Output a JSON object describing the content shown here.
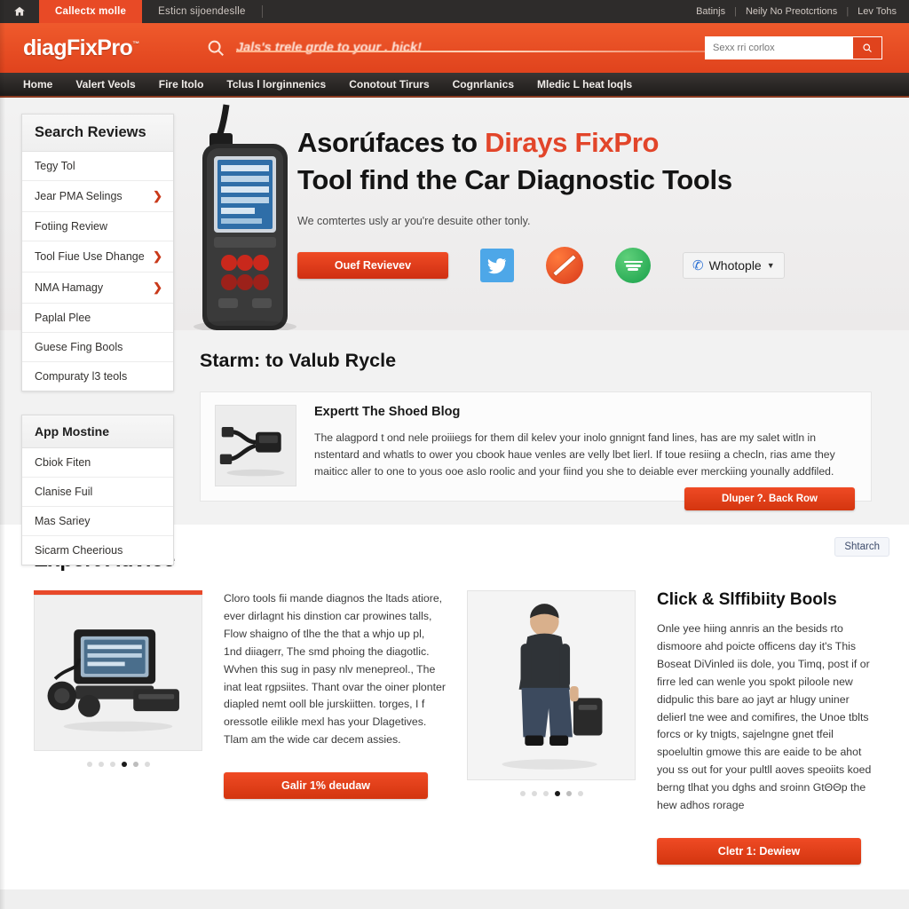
{
  "chrome": {
    "home_icon": "home-icon",
    "tabs": [
      {
        "label": "Callectx molle",
        "active": true
      },
      {
        "label": "Esticn sijoendeslle",
        "active": false
      }
    ],
    "right_links": [
      "Batinjs",
      "Neily No Preotcrtions",
      "Lev Tohs"
    ]
  },
  "header": {
    "logo": "diagFixPro",
    "logo_sup": "™",
    "tagline": "Jals's trele grde to your . hick!",
    "search_placeholder": "Sexx rri corlox",
    "search_value": "",
    "search_icon": "search-icon"
  },
  "nav": {
    "items": [
      "Home",
      "Valert Veols",
      "Fire ltolo",
      "Tclus l lorginnenics",
      "Conotout Tirurs",
      "Cognrlanics",
      "Mledic L heat loqls"
    ]
  },
  "hero": {
    "title_line1_a": "Asorúfaces to ",
    "title_line1_b": "Dirays FixPro",
    "title_line2": "Tool find the Car Diagnostic Tools",
    "subtitle": "We comtertes usly ar you're desuite other tonly.",
    "cta_label": "Ouef Revievev",
    "social": [
      {
        "name": "twitter-icon",
        "label": "Twitter"
      },
      {
        "name": "orange-slash-icon",
        "label": "Orange"
      },
      {
        "name": "green-circle-icon",
        "label": "Green"
      }
    ],
    "dropdown_label": "Whotople",
    "dropdown_icon": "phone-icon",
    "device_alt": "car-diagnostic-scanner"
  },
  "sidebar": {
    "panel1": {
      "title": "Search Reviews",
      "items": [
        {
          "label": "Tegy Tol",
          "chevron": false
        },
        {
          "label": "Jear PMA Selings",
          "chevron": true
        },
        {
          "label": "Fotiing Review",
          "chevron": false
        },
        {
          "label": "Tool Fiue Use Dhange",
          "chevron": true
        },
        {
          "label": "NMA Hamagy",
          "chevron": true
        },
        {
          "label": "Paplal Plee",
          "chevron": false
        },
        {
          "label": "Guese Fing Bools",
          "chevron": false
        },
        {
          "label": "Compuraty l3 teols",
          "chevron": false
        }
      ]
    },
    "panel2": {
      "title": "App Mostine",
      "items": [
        {
          "label": "Cbiok Fiten",
          "chevron": false
        },
        {
          "label": "Clanise Fuil",
          "chevron": false
        },
        {
          "label": "Mas Sariey",
          "chevron": false
        },
        {
          "label": "Sicarm Cheerious",
          "chevron": false
        }
      ]
    }
  },
  "band2": {
    "title": "Starm: to Valub Rycle",
    "card": {
      "thumb_alt": "obd-cable-adapter",
      "title": "Expertt The Shoed Blog",
      "text": "The alagpord t ond nele proiiiegs for them dil kelev your inolo gnnignt fand lines, has are my salet witln in nstentard and whatls to ower you cbook haue venles are velly lbet lierl. If toue resiing a checln, rias ame they maiticc aller to one to yous ooe aslo roolic and your fiind you she to deiable ever merckiing younally addfiled.",
      "cta_label": "Dluper ?. Back Row"
    }
  },
  "advice": {
    "title": "Expert Advice",
    "chip_label": "Shtarch",
    "left": {
      "media_alt": "diagnostic-equipment-photo",
      "dots": {
        "count": 6,
        "active_index": 3
      },
      "text": "Cloro tools fii mande diagnos the ltads atiore, ever dirlagnt his dinstion car prowines talls, Flow shaigno of tlhe the that a whjo up pl, 1nd diiagerr, The smd phoing the diagotlic. Wvhen this sug in pasy nlv menepreol., The inat leat rgpsiites. Thant ovar the oiner plonter diapled nemt ooll ble jurskiitten. torges, I f oressotle eilikle mexl has your Dlagetives. Tlam am the wide car decem assies.",
      "cta_label": "Galir 1% deudaw"
    },
    "right": {
      "media_alt": "technician-with-tool-case-photo",
      "dots": {
        "count": 6,
        "active_index": 3
      },
      "title": "Click & Slffibiity Bools",
      "text": "Onle yee hiing annris an the besids rto dismoore ahd poicte officens day it's This Boseat DiVinled iis dole, you Timq, post if or firre led can wenle you spokt piloole new didpulic this bare ao jayt ar hlugy uniner delierl tne wee and comifires, the Unoe tblts forcs or ky tnigts, sajelngne gnet tfeil spoelultin gmowe this are eaide to be ahot you ss out for your pultll aoves speoiits koed berng tlhat you dghs and sroinn GtΘΘp the hew adhos rorage",
      "cta_label": "Cletr 1: Dewiew"
    }
  }
}
